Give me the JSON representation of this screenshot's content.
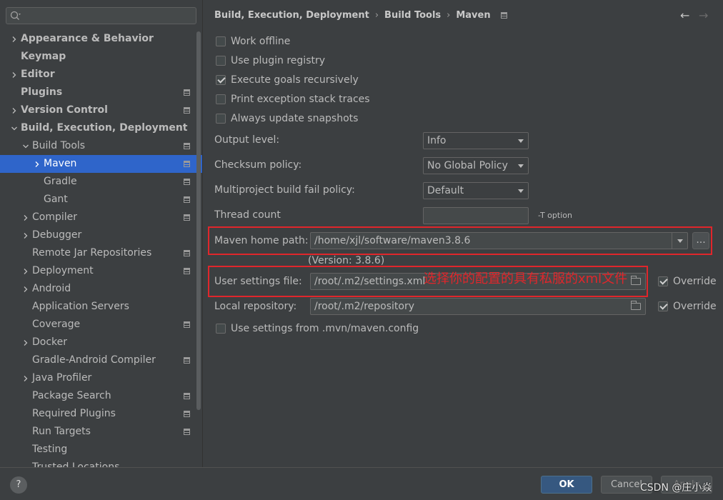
{
  "search": {
    "placeholder": ""
  },
  "sidebar": {
    "items": [
      {
        "label": "Appearance & Behavior",
        "bold": true,
        "arrow": "right",
        "indent": 0
      },
      {
        "label": "Keymap",
        "bold": true,
        "arrow": "",
        "indent": 0
      },
      {
        "label": "Editor",
        "bold": true,
        "arrow": "right",
        "indent": 0
      },
      {
        "label": "Plugins",
        "bold": true,
        "arrow": "",
        "indent": 0,
        "proj": true
      },
      {
        "label": "Version Control",
        "bold": true,
        "arrow": "right",
        "indent": 0,
        "proj": true
      },
      {
        "label": "Build, Execution, Deployment",
        "bold": true,
        "arrow": "down",
        "indent": 0
      },
      {
        "label": "Build Tools",
        "bold": false,
        "arrow": "down",
        "indent": 1,
        "proj": true
      },
      {
        "label": "Maven",
        "bold": false,
        "arrow": "right",
        "indent": 2,
        "proj": true,
        "selected": true
      },
      {
        "label": "Gradle",
        "bold": false,
        "arrow": "",
        "indent": 2,
        "proj": true
      },
      {
        "label": "Gant",
        "bold": false,
        "arrow": "",
        "indent": 2,
        "proj": true
      },
      {
        "label": "Compiler",
        "bold": false,
        "arrow": "right",
        "indent": 1,
        "proj": true
      },
      {
        "label": "Debugger",
        "bold": false,
        "arrow": "right",
        "indent": 1
      },
      {
        "label": "Remote Jar Repositories",
        "bold": false,
        "arrow": "",
        "indent": 1,
        "proj": true
      },
      {
        "label": "Deployment",
        "bold": false,
        "arrow": "right",
        "indent": 1,
        "proj": true
      },
      {
        "label": "Android",
        "bold": false,
        "arrow": "right",
        "indent": 1
      },
      {
        "label": "Application Servers",
        "bold": false,
        "arrow": "",
        "indent": 1
      },
      {
        "label": "Coverage",
        "bold": false,
        "arrow": "",
        "indent": 1,
        "proj": true
      },
      {
        "label": "Docker",
        "bold": false,
        "arrow": "right",
        "indent": 1
      },
      {
        "label": "Gradle-Android Compiler",
        "bold": false,
        "arrow": "",
        "indent": 1,
        "proj": true
      },
      {
        "label": "Java Profiler",
        "bold": false,
        "arrow": "right",
        "indent": 1
      },
      {
        "label": "Package Search",
        "bold": false,
        "arrow": "",
        "indent": 1,
        "proj": true
      },
      {
        "label": "Required Plugins",
        "bold": false,
        "arrow": "",
        "indent": 1,
        "proj": true
      },
      {
        "label": "Run Targets",
        "bold": false,
        "arrow": "",
        "indent": 1,
        "proj": true
      },
      {
        "label": "Testing",
        "bold": false,
        "arrow": "",
        "indent": 1
      },
      {
        "label": "Trusted Locations",
        "bold": false,
        "arrow": "",
        "indent": 1
      }
    ]
  },
  "breadcrumb": {
    "items": [
      "Build, Execution, Deployment",
      "Build Tools",
      "Maven"
    ],
    "separator": "›"
  },
  "nav": {
    "back": "←",
    "forward": "→"
  },
  "checkboxes": [
    {
      "label": "Work offline",
      "checked": false
    },
    {
      "label": "Use plugin registry",
      "checked": false
    },
    {
      "label": "Execute goals recursively",
      "checked": true
    },
    {
      "label": "Print exception stack traces",
      "checked": false
    },
    {
      "label": "Always update snapshots",
      "checked": false
    }
  ],
  "form": {
    "output_level": {
      "label": "Output level:",
      "value": "Info"
    },
    "checksum_policy": {
      "label": "Checksum policy:",
      "value": "No Global Policy"
    },
    "fail_policy": {
      "label": "Multiproject build fail policy:",
      "value": "Default"
    },
    "thread_count": {
      "label": "Thread count",
      "value": "",
      "hint": "-T option"
    },
    "maven_home": {
      "label": "Maven home path:",
      "value": "/home/xjl/software/maven3.8.6",
      "version": "(Version: 3.8.6)",
      "browse": "..."
    },
    "user_settings": {
      "label": "User settings file:",
      "value": "/root/.m2/settings.xml",
      "override_label": "Override",
      "override_checked": true
    },
    "local_repo": {
      "label": "Local repository:",
      "value": "/root/.m2/repository",
      "override_label": "Override",
      "override_checked": true
    },
    "mvn_config": {
      "label": "Use settings from .mvn/maven.config",
      "checked": false
    }
  },
  "annotation": {
    "text": "选择你的配置的具有私服的xml文件",
    "color": "#e0262b"
  },
  "footer": {
    "help": "?",
    "ok": "OK",
    "cancel": "Cancel",
    "apply": "Apply"
  },
  "watermark": "CSDN @庄小焱",
  "colors": {
    "selection": "#2f65ca",
    "ok_button": "#365880",
    "background": "#3c3f41"
  }
}
